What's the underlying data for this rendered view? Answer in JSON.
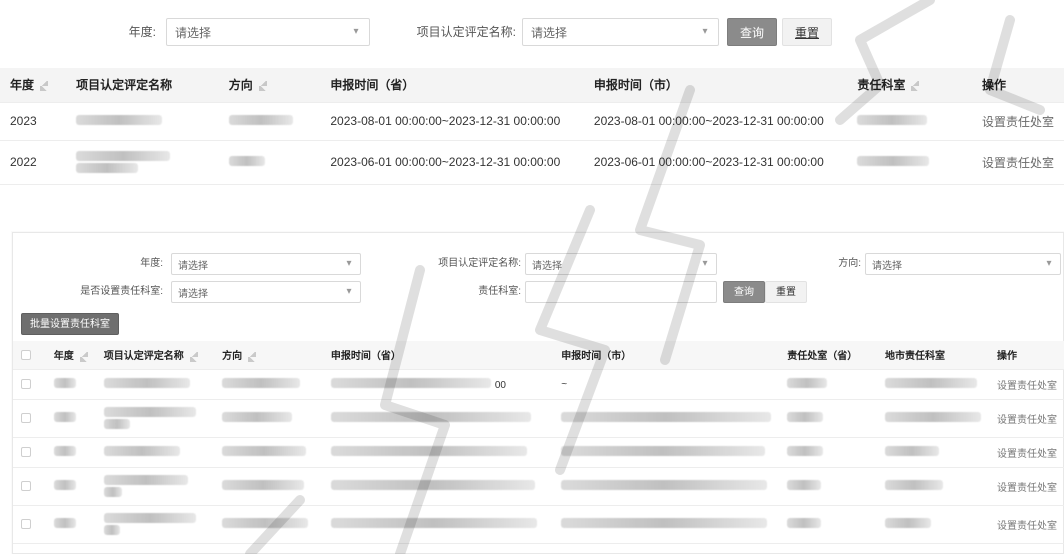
{
  "colors": {
    "accent": "#8b8b8b",
    "header_bg": "#f4f4f4",
    "text": "#2f2f2f"
  },
  "top": {
    "filters": {
      "year_label": "年度:",
      "year_placeholder": "请选择",
      "project_label": "项目认定评定名称:",
      "project_placeholder": "请选择",
      "query_button": "查询",
      "reset_button": "重置"
    },
    "table": {
      "headers": [
        "年度",
        "项目认定评定名称",
        "方向",
        "申报时间（省）",
        "申报时间（市）",
        "责任科室",
        "操作"
      ],
      "rows": [
        {
          "year": "2023",
          "prov_time": "2023-08-01 00:00:00~2023-12-31 00:00:00",
          "city_time": "2023-08-01 00:00:00~2023-12-31 00:00:00",
          "action": "设置责任处室"
        },
        {
          "year": "2022",
          "prov_time": "2023-06-01 00:00:00~2023-12-31 00:00:00",
          "city_time": "2023-06-01 00:00:00~2023-12-31 00:00:00",
          "action": "设置责任处室"
        }
      ]
    }
  },
  "lower": {
    "filters": {
      "year_label": "年度:",
      "year_placeholder": "请选择",
      "project_label": "项目认定评定名称:",
      "project_placeholder": "请选择",
      "direction_label": "方向:",
      "direction_placeholder": "请选择",
      "whether_set_label": "是否设置责任科室:",
      "whether_set_placeholder": "请选择",
      "dept_label": "责任科室:",
      "query_button": "查询",
      "reset_button": "重置",
      "batch_button": "批量设置责任科室"
    },
    "table": {
      "headers": [
        "年度",
        "项目认定评定名称",
        "方向",
        "申报时间（省）",
        "申报时间（市）",
        "责任处室（省）",
        "地市责任科室",
        "操作"
      ],
      "rows": [
        {
          "city_time": "~",
          "prov_suffix": "00",
          "action": "设置责任处室"
        },
        {
          "city_time": "",
          "prov_suffix": "",
          "action": "设置责任处室"
        },
        {
          "city_time": "",
          "prov_suffix": "",
          "action": "设置责任处室"
        },
        {
          "city_time": "",
          "prov_suffix": "",
          "action": "设置责任处室"
        },
        {
          "city_time": "",
          "prov_suffix": "",
          "action": "设置责任处室"
        }
      ]
    }
  }
}
